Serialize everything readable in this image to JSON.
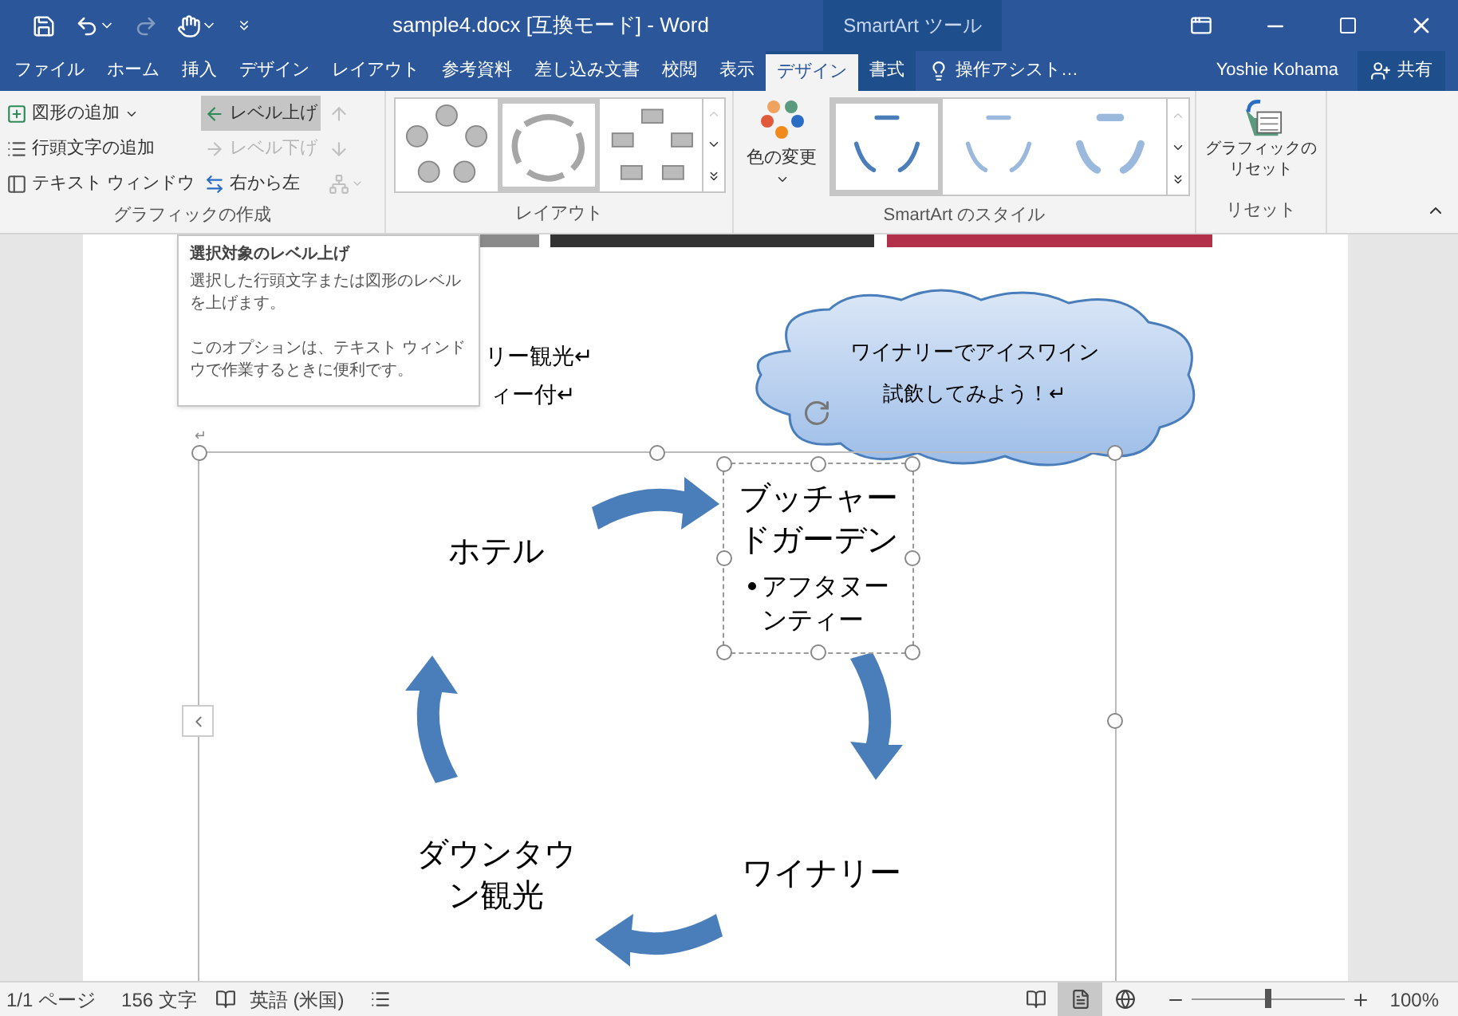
{
  "title_bar": {
    "title": "sample4.docx [互換モード] - Word",
    "contextual_header": "SmartArt ツール",
    "redo_disabled": true
  },
  "tabs": [
    {
      "label": "ファイル",
      "selected": false,
      "contextual": false
    },
    {
      "label": "ホーム",
      "selected": false,
      "contextual": false
    },
    {
      "label": "挿入",
      "selected": false,
      "contextual": false
    },
    {
      "label": "デザイン",
      "selected": false,
      "contextual": false
    },
    {
      "label": "レイアウト",
      "selected": false,
      "contextual": false
    },
    {
      "label": "参考資料",
      "selected": false,
      "contextual": false
    },
    {
      "label": "差し込み文書",
      "selected": false,
      "contextual": false
    },
    {
      "label": "校閲",
      "selected": false,
      "contextual": false
    },
    {
      "label": "表示",
      "selected": false,
      "contextual": false
    },
    {
      "label": "デザイン",
      "selected": true,
      "contextual": true
    },
    {
      "label": "書式",
      "selected": false,
      "contextual": true
    }
  ],
  "tell_me": "操作アシスト…",
  "user": "Yoshie Kohama",
  "share": "共有",
  "ribbon": {
    "create_graphic": {
      "caption": "グラフィックの作成",
      "buttons": [
        {
          "kind": "add-shape",
          "label": "図形の追加",
          "disabled": false,
          "highlighted": false
        },
        {
          "kind": "add-bullet",
          "label": "行頭文字の追加",
          "disabled": false,
          "highlighted": false
        },
        {
          "kind": "text-pane",
          "label": "テキスト ウィンドウ",
          "disabled": false,
          "highlighted": false
        },
        {
          "kind": "promote",
          "label": "レベル上げ",
          "disabled": false,
          "highlighted": true
        },
        {
          "kind": "demote",
          "label": "レベル下げ",
          "disabled": true,
          "highlighted": false
        },
        {
          "kind": "right-to-left",
          "label": "右から左",
          "disabled": false,
          "highlighted": false
        },
        {
          "kind": "move-up",
          "disabled": true,
          "highlighted": false
        },
        {
          "kind": "move-down",
          "disabled": true,
          "highlighted": false
        },
        {
          "kind": "org-layout",
          "disabled": true,
          "highlighted": false
        }
      ]
    },
    "layouts": {
      "caption": "レイアウト",
      "items": [
        {
          "kind": "circles",
          "selected": false
        },
        {
          "kind": "arrows",
          "selected": true
        },
        {
          "kind": "boxes",
          "selected": false
        }
      ]
    },
    "styles": {
      "caption": "SmartArt のスタイル",
      "change_colors": "色の変更",
      "items": [
        {
          "kind": "flat",
          "selected": true
        },
        {
          "kind": "shadow",
          "selected": false
        },
        {
          "kind": "bevel",
          "selected": false
        }
      ]
    },
    "reset": {
      "caption": "リセット",
      "label_lines": [
        "グラフィックの",
        "リセット"
      ]
    }
  },
  "tooltip": {
    "title": "選択対象のレベル上げ",
    "body": "選択した行頭文字または図形のレベルを上げます。",
    "note": "このオプションは、テキスト ウィンドウで作業するときに便利です。"
  },
  "document": {
    "lines": [
      "リー観光↵",
      "ィー付↵"
    ],
    "paragraph_mark": "↵",
    "callout": [
      "ワイナリーでアイスワイン",
      "試飲してみよう！↵"
    ],
    "smartart": {
      "nodes": [
        {
          "kind": "plain",
          "lines": [
            "ホテル"
          ]
        },
        {
          "kind": "selected",
          "lines": [
            "ブッチャー",
            "ドガーデン"
          ],
          "bullet": [
            "アフタヌー",
            "ンティー"
          ]
        },
        {
          "kind": "plain",
          "lines": [
            "ワイナリー"
          ]
        },
        {
          "kind": "plain",
          "lines": [
            "ダウンタウ",
            "ン観光"
          ]
        }
      ]
    }
  },
  "status_bar": {
    "page": "1/1 ページ",
    "words": "156 文字",
    "language": "英語 (米国)",
    "views": [
      {
        "kind": "read",
        "selected": false
      },
      {
        "kind": "print",
        "selected": true
      },
      {
        "kind": "web",
        "selected": false
      }
    ],
    "zoom": {
      "level": 0.5,
      "reading": "100%"
    }
  }
}
